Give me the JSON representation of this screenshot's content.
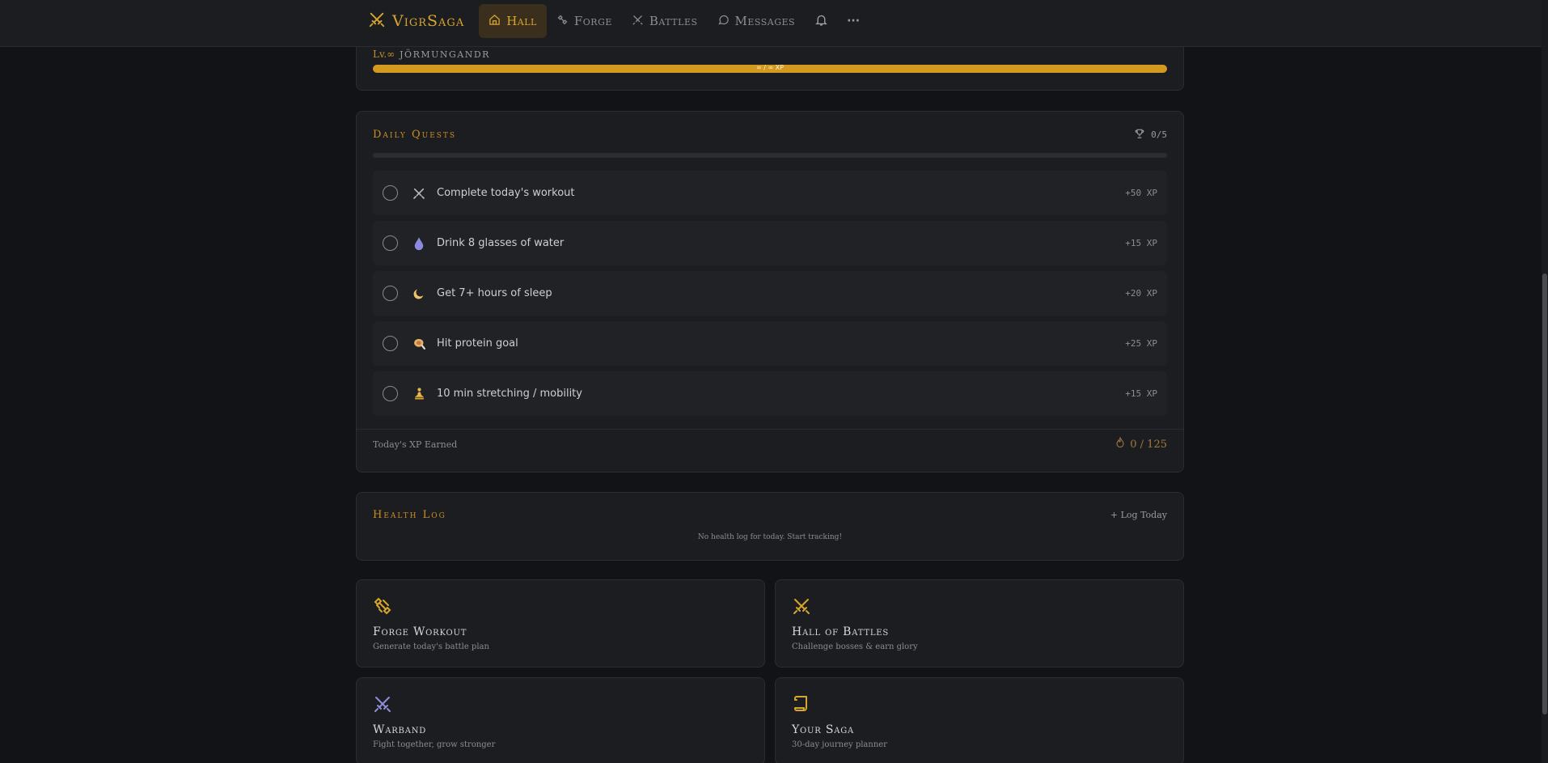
{
  "nav": {
    "brand": "VigrSaga",
    "items": [
      {
        "label": "Hall",
        "icon": "home-icon",
        "active": true
      },
      {
        "label": "Forge",
        "icon": "dumbbell-icon",
        "active": false
      },
      {
        "label": "Battles",
        "icon": "crossed-swords-icon",
        "active": false
      },
      {
        "label": "Messages",
        "icon": "chat-bubble-icon",
        "active": false
      }
    ],
    "bell_icon": "bell-icon",
    "more_label": "···"
  },
  "level": {
    "lv": "Lv.∞",
    "name": "JÖRMUNGANDR",
    "xp_text": "∞ / ∞ XP",
    "fill": 1.0
  },
  "quests": {
    "title": "Daily Quests",
    "count": "0/5",
    "progress": 0,
    "items": [
      {
        "emoji": "⚔",
        "label": "Complete today's workout",
        "xp": "+50 XP"
      },
      {
        "emoji": "💧",
        "label": "Drink 8 glasses of water",
        "xp": "+15 XP"
      },
      {
        "emoji": "🌙",
        "label": "Get 7+ hours of sleep",
        "xp": "+20 XP"
      },
      {
        "emoji": "🥩",
        "label": "Hit protein goal",
        "xp": "+25 XP"
      },
      {
        "emoji": "🧘",
        "label": "10 min stretching / mobility",
        "xp": "+15 XP"
      }
    ],
    "footer_label": "Today's XP Earned",
    "footer_value": "0 / 125"
  },
  "health": {
    "title": "Health Log",
    "action": "+ Log Today",
    "empty": "No health log for today. Start tracking!"
  },
  "tiles": [
    {
      "title": "Forge Workout",
      "subtitle": "Generate today's battle plan",
      "icon": "dumbbell-icon"
    },
    {
      "title": "Hall of Battles",
      "subtitle": "Challenge bosses & earn glory",
      "icon": "crossed-swords-icon"
    },
    {
      "title": "Warband",
      "subtitle": "Fight together, grow stronger",
      "icon": "crossed-swords-icon"
    },
    {
      "title": "Your Saga",
      "subtitle": "30-day journey planner",
      "icon": "scroll-icon"
    }
  ],
  "colors": {
    "accent": "#d9a52c",
    "background": "#121316",
    "card": "#1c1d21",
    "warband_icon": "#8f8fd8"
  }
}
